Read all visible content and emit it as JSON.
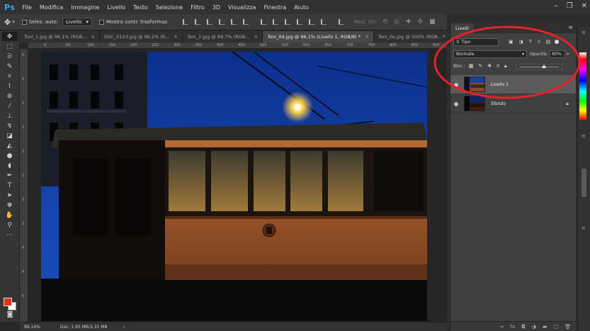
{
  "app": {
    "logo": "Ps",
    "menus": [
      "File",
      "Modifica",
      "Immagine",
      "Livello",
      "Testo",
      "Selezione",
      "Filtro",
      "3D",
      "Visualizza",
      "Finestra",
      "Aiuto"
    ]
  },
  "options": {
    "auto_select_label": "Selez. auto:",
    "auto_select_value": "Livello",
    "show_transform_label": "Mostra contr. trasformaz.",
    "mode_3d_label": "Mod. 3D:"
  },
  "tabs": [
    {
      "label": "Toni_1.jpg @ 96,1% (RGB..."
    },
    {
      "label": "DSC_0123.jpg @ 96,1% (R..."
    },
    {
      "label": "Toni_2.jpg @ 89,7% (RGB..."
    },
    {
      "label": "Toni_0d.jpg @ 96,1% (Livello 1, RGB/8) *"
    },
    {
      "label": "Toni_0e.jpg @ 100% (RGB..."
    }
  ],
  "ruler_marks": [
    "0",
    "50",
    "100",
    "150",
    "200",
    "250",
    "300",
    "350",
    "400",
    "450",
    "500",
    "550",
    "600",
    "650",
    "700",
    "750",
    "800",
    "850",
    "900"
  ],
  "ruler_left_marks": [
    "0",
    "5",
    "1",
    "1",
    "2",
    "2",
    "3",
    "3",
    "4",
    "4",
    "5"
  ],
  "status": {
    "zoom": "96,14%",
    "doc": "Doc: 1,65 MB/3,31 MB"
  },
  "layers_panel": {
    "tab_label": "Livelli",
    "filter_label": "Tipo",
    "blend_mode": "Normale",
    "opacity_label": "Opacità:",
    "opacity_value": "60%",
    "lock_label": "Bloc.:",
    "opacity_fraction": 0.6,
    "layers": [
      {
        "name": "Livello 1",
        "selected": true,
        "locked": false
      },
      {
        "name": "Sfondo",
        "selected": false,
        "locked": true
      }
    ]
  },
  "colors": {
    "accent": "#31a8ff",
    "foreground_swatch": "#e2341d",
    "background_swatch": "#ffffff",
    "annotation": "#e8202a"
  }
}
